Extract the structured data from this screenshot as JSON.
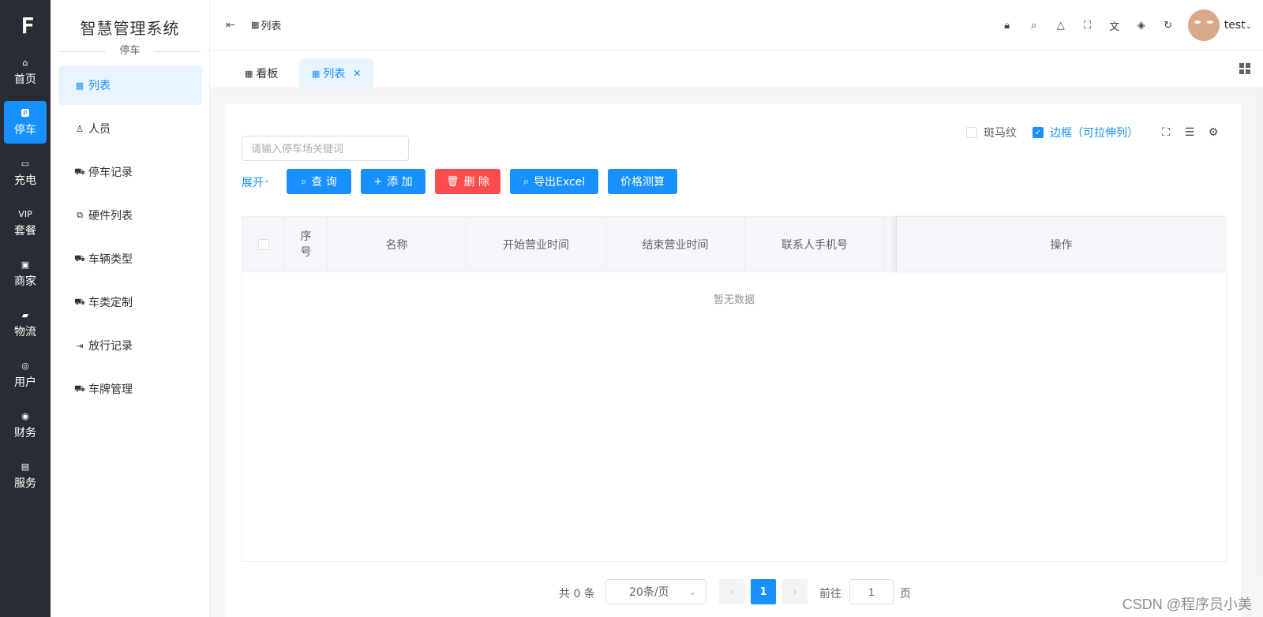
{
  "rail": {
    "items": [
      {
        "label": "首页",
        "icon": "home-icon",
        "glyph": "⌂",
        "active": false
      },
      {
        "label": "停车",
        "icon": "parking-icon",
        "glyph": "🅿",
        "active": true
      },
      {
        "label": "充电",
        "icon": "battery-icon",
        "glyph": "▭",
        "active": false
      },
      {
        "label": "套餐",
        "icon": "vip-icon",
        "glyph": "VIP",
        "active": false
      },
      {
        "label": "商家",
        "icon": "shop-icon",
        "glyph": "▣",
        "active": false
      },
      {
        "label": "物流",
        "icon": "truck-icon",
        "glyph": "▰",
        "active": false
      },
      {
        "label": "用户",
        "icon": "user-icon",
        "glyph": "◎",
        "active": false
      },
      {
        "label": "财务",
        "icon": "finance-icon",
        "glyph": "◉",
        "active": false
      },
      {
        "label": "服务",
        "icon": "service-icon",
        "glyph": "▤",
        "active": false
      }
    ]
  },
  "submenu": {
    "title": "智慧管理系统",
    "group": "停车",
    "items": [
      {
        "label": "列表",
        "icon": "grid-icon",
        "active": true
      },
      {
        "label": "人员",
        "icon": "person-icon",
        "active": false
      },
      {
        "label": "停车记录",
        "icon": "car-icon",
        "active": false
      },
      {
        "label": "硬件列表",
        "icon": "hardware-icon",
        "active": false
      },
      {
        "label": "车辆类型",
        "icon": "car-icon",
        "active": false
      },
      {
        "label": "车类定制",
        "icon": "car-icon",
        "active": false
      },
      {
        "label": "放行记录",
        "icon": "exit-icon",
        "active": false
      },
      {
        "label": "车牌管理",
        "icon": "car-icon",
        "active": false
      }
    ]
  },
  "header": {
    "breadcrumb": "列表",
    "username": "test"
  },
  "tabs": [
    {
      "label": "看板",
      "active": false
    },
    {
      "label": "列表",
      "active": true
    }
  ],
  "search": {
    "placeholder": "请输入停车场关键词"
  },
  "toolbar": {
    "expand_label": "展开",
    "query_label": "查 询",
    "add_label": "添 加",
    "delete_label": "删 除",
    "export_label": "导出Excel",
    "price_label": "价格测算"
  },
  "options": {
    "stripe_label": "斑马纹",
    "stripe_checked": false,
    "border_label": "边框（可拉伸列）",
    "border_checked": true
  },
  "table": {
    "columns": [
      "序号",
      "名称",
      "开始营业时间",
      "结束营业时间",
      "联系人手机号",
      "",
      "操作"
    ],
    "empty_text": "暂无数据"
  },
  "pagination": {
    "total_label": "共 0 条",
    "page_size": "20条/页",
    "current_page": "1",
    "goto_label": "前往",
    "goto_value": "1",
    "page_suffix": "页"
  },
  "watermark": "CSDN @程序员小美",
  "colors": {
    "primary": "#1890ff",
    "danger": "#ff4d4f",
    "sidebar": "#282c34"
  }
}
